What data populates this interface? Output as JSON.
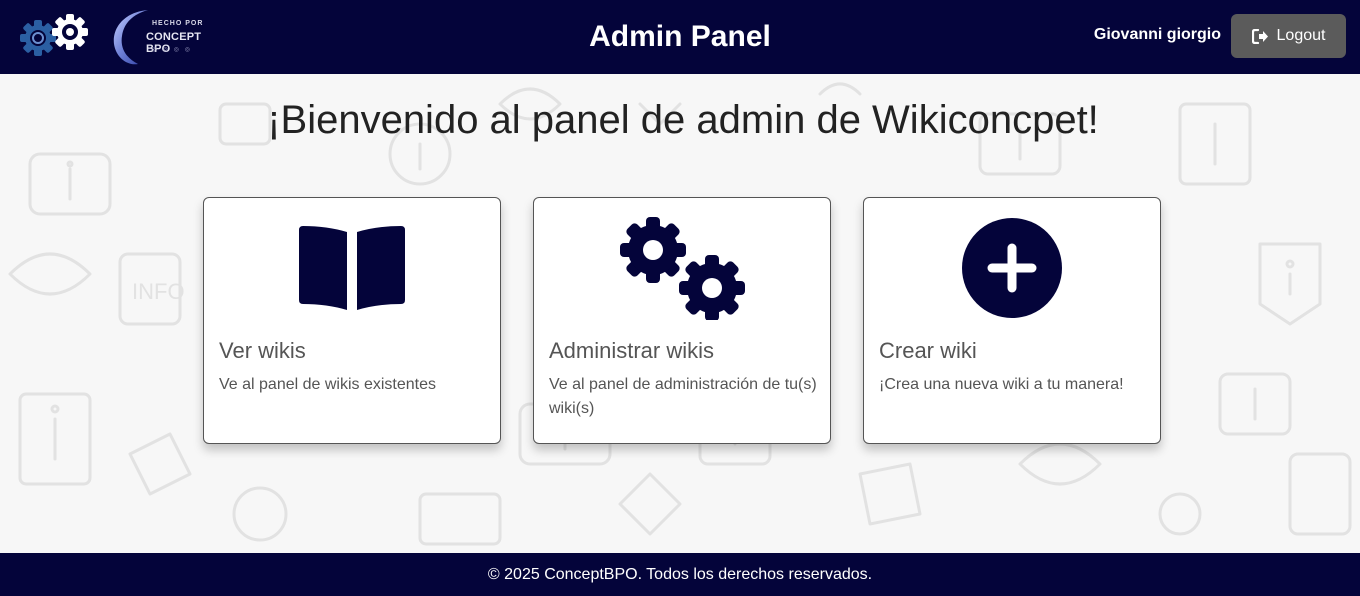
{
  "header": {
    "title": "Admin Panel",
    "user_name": "Giovanni giorgio",
    "logout_label": "Logout",
    "brand": {
      "top": "HECHO POR",
      "main": "CONCEPT BPO"
    }
  },
  "main": {
    "welcome": "¡Bienvenido al panel de admin de Wikiconcpet!",
    "cards": [
      {
        "title": "Ver wikis",
        "description": "Ve al panel de wikis existentes",
        "icon": "book-open-icon"
      },
      {
        "title": "Administrar wikis",
        "description": "Ve al panel de administración de tu(s) wiki(s)",
        "icon": "gears-icon"
      },
      {
        "title": "Crear wiki",
        "description": "¡Crea una nueva wiki a tu manera!",
        "icon": "plus-circle-icon"
      }
    ]
  },
  "footer": {
    "text": "© 2025 ConceptBPO. Todos los derechos reservados."
  },
  "colors": {
    "navbar": "#04043a",
    "icon": "#04043a",
    "logout_button": "#5b5b5b",
    "background": "#f7f7f7"
  }
}
